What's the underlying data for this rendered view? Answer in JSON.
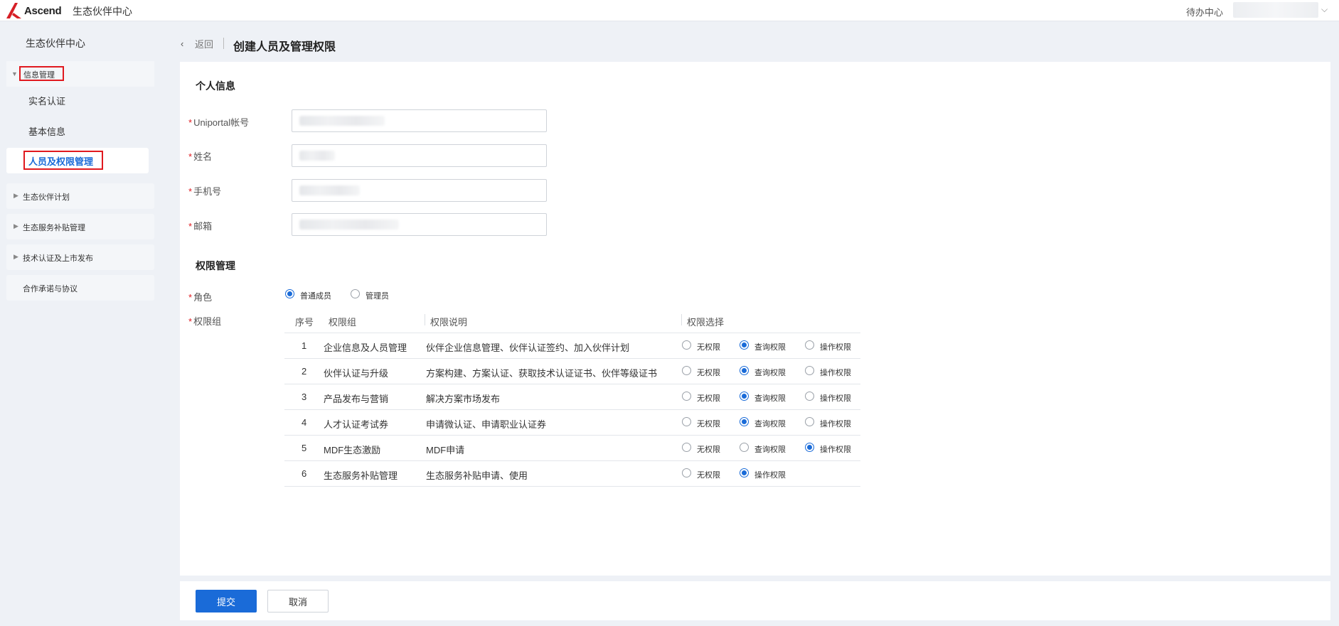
{
  "topbar": {
    "logo_text": "Ascend",
    "title": "生态伙伴中心",
    "todo": "待办中心",
    "chevron": "⌵"
  },
  "sidebar": {
    "heading": "生态伙伴中心",
    "info_group": {
      "label": "信息管理",
      "items": [
        "实名认证",
        "基本信息",
        "人员及权限管理"
      ]
    },
    "groups": [
      "生态伙伴计划",
      "生态服务补贴管理",
      "技术认证及上市发布",
      "合作承诺与协议"
    ]
  },
  "header": {
    "back": "返回",
    "title": "创建人员及管理权限"
  },
  "personal": {
    "title": "个人信息",
    "required_mark": "*",
    "fields": [
      {
        "label": "Uniportal帐号"
      },
      {
        "label": "姓名"
      },
      {
        "label": "手机号"
      },
      {
        "label": "邮箱"
      }
    ]
  },
  "permissions": {
    "title": "权限管理",
    "role_label": "角色",
    "roles": [
      "普通成员",
      "管理员"
    ],
    "selected_role": "普通成员",
    "group_label": "权限组",
    "columns": [
      "序号",
      "权限组",
      "权限说明",
      "权限选择"
    ],
    "rows": [
      {
        "no": "1",
        "group": "企业信息及人员管理",
        "desc": "伙伴企业信息管理、伙伴认证签约、加入伙伴计划",
        "options": [
          "无权限",
          "查询权限",
          "操作权限"
        ],
        "selected": "查询权限"
      },
      {
        "no": "2",
        "group": "伙伴认证与升级",
        "desc": "方案构建、方案认证、获取技术认证证书、伙伴等级证书",
        "options": [
          "无权限",
          "查询权限",
          "操作权限"
        ],
        "selected": "查询权限"
      },
      {
        "no": "3",
        "group": "产品发布与营销",
        "desc": "解决方案市场发布",
        "options": [
          "无权限",
          "查询权限",
          "操作权限"
        ],
        "selected": "查询权限"
      },
      {
        "no": "4",
        "group": "人才认证考试券",
        "desc": "申请微认证、申请职业认证券",
        "options": [
          "无权限",
          "查询权限",
          "操作权限"
        ],
        "selected": "查询权限"
      },
      {
        "no": "5",
        "group": "MDF生态激励",
        "desc": "MDF申请",
        "options": [
          "无权限",
          "查询权限",
          "操作权限"
        ],
        "selected": "操作权限"
      },
      {
        "no": "6",
        "group": "生态服务补贴管理",
        "desc": "生态服务补贴申请、使用",
        "options": [
          "无权限",
          "操作权限"
        ],
        "selected": "操作权限"
      }
    ]
  },
  "footer": {
    "submit": "提交",
    "cancel": "取消"
  },
  "colors": {
    "accent": "#1a6bd8",
    "highlight_box": "#e0191f",
    "required": "#e0191f",
    "background": "#eef1f6"
  },
  "icons": {
    "logo": "ascend-logo-icon",
    "back": "chevron-left-icon",
    "user_menu": "chevron-down-icon",
    "expanded": "caret-down-icon",
    "collapsed": "caret-right-icon"
  }
}
